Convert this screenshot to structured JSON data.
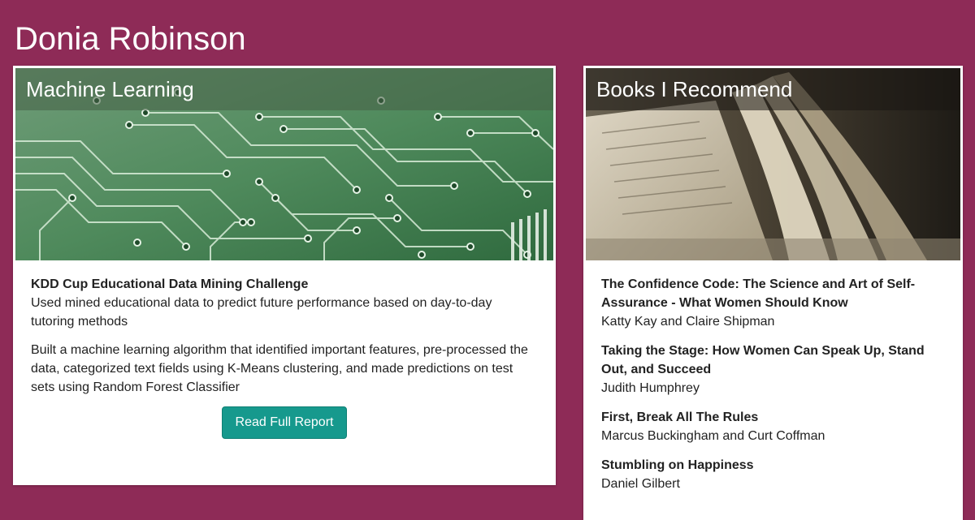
{
  "header": {
    "title": "Donia Robinson"
  },
  "colors": {
    "background": "#8e2b57",
    "button": "#16998d"
  },
  "ml_card": {
    "title": "Machine Learning",
    "image_icon": "circuit-board-image",
    "project_title": "KDD Cup Educational Data Mining Challenge",
    "project_summary": "Used mined educational data to predict future performance based on day-to-day tutoring methods",
    "project_detail": "Built a machine learning algorithm that identified important features, pre-processed the data, categorized text fields using K-Means clustering, and made predictions on test sets using Random Forest Classifier",
    "button_label": "Read Full Report"
  },
  "books_card": {
    "title": "Books I Recommend",
    "image_icon": "open-book-image",
    "books": [
      {
        "title": "The Confidence Code: The Science and Art of Self-Assurance - What Women Should Know",
        "author": "Katty Kay and Claire Shipman"
      },
      {
        "title": "Taking the Stage: How Women Can Speak Up, Stand Out, and Succeed",
        "author": "Judith Humphrey"
      },
      {
        "title": "First, Break All The Rules",
        "author": "Marcus Buckingham and Curt Coffman"
      },
      {
        "title": "Stumbling on Happiness",
        "author": "Daniel Gilbert"
      }
    ]
  }
}
